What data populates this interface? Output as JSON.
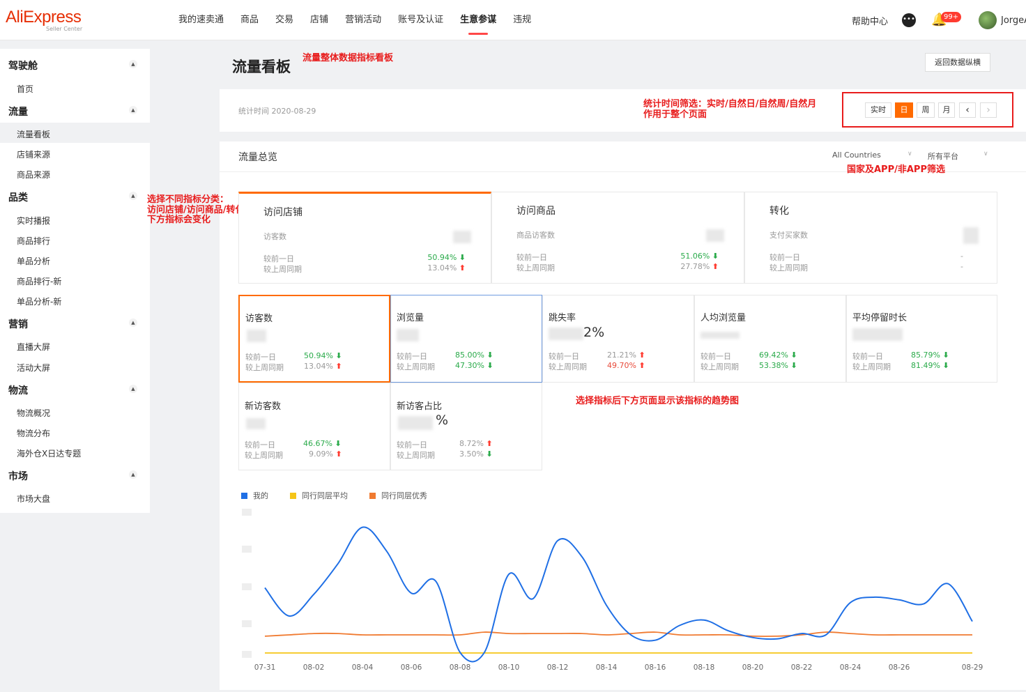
{
  "brand": {
    "name": "AliExpress",
    "sub": "Seller Center"
  },
  "topnav": [
    "我的速卖通",
    "商品",
    "交易",
    "店铺",
    "营销活动",
    "账号及认证",
    "生意参谋",
    "违规"
  ],
  "topnav_active": "生意参谋",
  "top_right": {
    "help": "帮助中心",
    "badge": "99+",
    "username": "JorgeA"
  },
  "sidebar": {
    "groups": [
      {
        "label": "驾驶舱",
        "items": [
          "首页"
        ]
      },
      {
        "label": "流量",
        "items": [
          "流量看板",
          "店铺来源",
          "商品来源"
        ]
      },
      {
        "label": "品类",
        "items": [
          "实时播报",
          "商品排行",
          "单品分析",
          "商品排行-新",
          "单品分析-新"
        ]
      },
      {
        "label": "营销",
        "items": [
          "直播大屏",
          "活动大屏"
        ]
      },
      {
        "label": "物流",
        "items": [
          "物流概况",
          "物流分布",
          "海外仓X日达专题"
        ]
      },
      {
        "label": "市场",
        "items": [
          "市场大盘"
        ]
      }
    ],
    "active_item": "流量看板"
  },
  "header": {
    "title": "流量看板",
    "back_button": "返回数据纵横",
    "stat_time": "统计时间 2020-08-29"
  },
  "time_filter": {
    "options": [
      "实时",
      "日",
      "周",
      "月"
    ],
    "active": "日",
    "prev": "‹",
    "next": "›"
  },
  "overview": {
    "title": "流量总览",
    "country_select": "All Countries",
    "platform_select": "所有平台"
  },
  "annotations": {
    "title_note": "流量整体数据指标看板",
    "time_note_1": "统计时间筛选：实时/自然日/自然周/自然月",
    "time_note_2": "作用于整个页面",
    "filter_note": "国家及APP/非APP筛选",
    "side_note_1": "选择不同指标分类：",
    "side_note_2": "访问店铺/访问商品/转化",
    "side_note_3": "下方指标会变化",
    "chart_note": "选择指标后下方页面显示该指标的趋势图"
  },
  "tabs": [
    {
      "title": "访问店铺",
      "sub": "访客数",
      "l1": "较前一日",
      "l2": "较上周同期",
      "v1": "50.94%",
      "v1_dir": "down",
      "v2": "13.04%",
      "v2_dir": "up",
      "active": true
    },
    {
      "title": "访问商品",
      "sub": "商品访客数",
      "l1": "较前一日",
      "l2": "较上周同期",
      "v1": "51.06%",
      "v1_dir": "down",
      "v2": "27.78%",
      "v2_dir": "up",
      "active": false
    },
    {
      "title": "转化",
      "sub": "支付买家数",
      "l1": "较前一日",
      "l2": "较上周同期",
      "v1": "-",
      "v1_dir": "",
      "v2": "-",
      "v2_dir": "",
      "active": false
    }
  ],
  "metrics": [
    {
      "title": "访客数",
      "suffix": "",
      "l1": "较前一日",
      "l2": "较上周同期",
      "v1": "50.94%",
      "v1_dir": "down",
      "v2": "13.04%",
      "v2_dir": "up"
    },
    {
      "title": "浏览量",
      "suffix": "",
      "l1": "较前一日",
      "l2": "较上周同期",
      "v1": "85.00%",
      "v1_dir": "down",
      "v2": "47.30%",
      "v2_dir": "down"
    },
    {
      "title": "跳失率",
      "suffix": "2%",
      "l1": "较前一日",
      "l2": "较上周同期",
      "v1": "21.21%",
      "v1_dir": "up",
      "v2": "49.70%",
      "v2_dir": "up"
    },
    {
      "title": "人均浏览量",
      "suffix": "",
      "l1": "较前一日",
      "l2": "较上周同期",
      "v1": "69.42%",
      "v1_dir": "down",
      "v2": "53.38%",
      "v2_dir": "down"
    },
    {
      "title": "平均停留时长",
      "suffix": "",
      "l1": "较前一日",
      "l2": "较上周同期",
      "v1": "85.79%",
      "v1_dir": "down",
      "v2": "81.49%",
      "v2_dir": "down"
    },
    {
      "title": "新访客数",
      "suffix": "",
      "l1": "较前一日",
      "l2": "较上周同期",
      "v1": "46.67%",
      "v1_dir": "down",
      "v2": "9.09%",
      "v2_dir": "up"
    },
    {
      "title": "新访客占比",
      "suffix": "%",
      "l1": "较前一日",
      "l2": "较上周同期",
      "v1": "8.72%",
      "v1_dir": "up",
      "v2": "3.50%",
      "v2_dir": "down"
    }
  ],
  "colors": {
    "accent": "#ff6a00",
    "blue": "#1f6fe5",
    "yellow": "#f5c518",
    "orange": "#f07a30",
    "annotation": "#e81c1c",
    "up": "#ff3b30",
    "down": "#2aaa4a"
  },
  "chart_data": {
    "type": "line",
    "x": [
      "07-31",
      "08-01",
      "08-02",
      "08-03",
      "08-04",
      "08-05",
      "08-06",
      "08-07",
      "08-08",
      "08-09",
      "08-10",
      "08-11",
      "08-12",
      "08-13",
      "08-14",
      "08-15",
      "08-16",
      "08-17",
      "08-18",
      "08-19",
      "08-20",
      "08-21",
      "08-22",
      "08-23",
      "08-24",
      "08-25",
      "08-26",
      "08-27",
      "08-28",
      "08-29"
    ],
    "tick_labels": [
      "07-31",
      "08-02",
      "08-04",
      "08-06",
      "08-08",
      "08-10",
      "08-12",
      "08-14",
      "08-16",
      "08-18",
      "08-20",
      "08-22",
      "08-24",
      "08-26",
      "08-29"
    ],
    "legend": "top-left",
    "grid": false,
    "ylim": [
      0,
      1
    ],
    "series": [
      {
        "name": "我的",
        "color": "#1f6fe5",
        "values": [
          0.49,
          0.28,
          0.44,
          0.67,
          0.94,
          0.76,
          0.45,
          0.54,
          0.01,
          0.01,
          0.59,
          0.41,
          0.84,
          0.72,
          0.36,
          0.14,
          0.1,
          0.21,
          0.25,
          0.17,
          0.12,
          0.11,
          0.15,
          0.14,
          0.38,
          0.42,
          0.4,
          0.37,
          0.52,
          0.24
        ]
      },
      {
        "name": "同行同层平均",
        "color": "#f5c518",
        "values": [
          0.005,
          0.005,
          0.005,
          0.005,
          0.005,
          0.005,
          0.005,
          0.005,
          0.005,
          0.005,
          0.005,
          0.005,
          0.005,
          0.005,
          0.005,
          0.005,
          0.005,
          0.005,
          0.005,
          0.005,
          0.005,
          0.005,
          0.005,
          0.005,
          0.005,
          0.005,
          0.005,
          0.005,
          0.005,
          0.005
        ]
      },
      {
        "name": "同行同层优秀",
        "color": "#f07a30",
        "values": [
          0.13,
          0.14,
          0.15,
          0.15,
          0.14,
          0.14,
          0.14,
          0.14,
          0.14,
          0.16,
          0.15,
          0.15,
          0.15,
          0.15,
          0.14,
          0.15,
          0.16,
          0.14,
          0.14,
          0.14,
          0.13,
          0.13,
          0.14,
          0.16,
          0.15,
          0.14,
          0.14,
          0.14,
          0.14,
          0.14
        ]
      }
    ]
  }
}
